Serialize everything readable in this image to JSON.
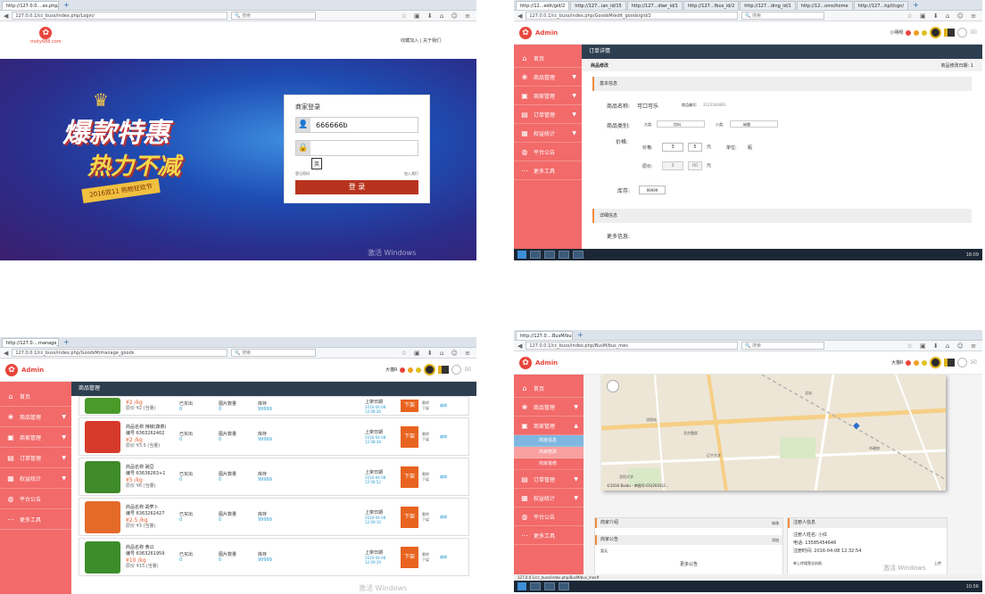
{
  "login": {
    "tab": "http://127.0.0....es.php/Login/",
    "url": "127.0.0.1/cc_buss/index.php/Login/",
    "search_placeholder": "搜索",
    "site": "moty688.com",
    "top_links": [
      "收藏加入",
      "关于我们"
    ],
    "banner": {
      "line1": "爆款特惠",
      "line2": "热力不减",
      "ribbon": "2016双11 购物狂欢节"
    },
    "form_title": "商家登录",
    "username": "666666b",
    "key_hint": "英",
    "remember": "登记密码",
    "register": "加入我们",
    "submit": "登 录",
    "watermark": "激活 Windows"
  },
  "edit": {
    "tabs": [
      "http://12...edit/gid/2",
      "http://127...ian_id/15",
      "http://127...diwr_id/1",
      "http://127...fbus_id/2",
      "http://127...ding_id/1",
      "http://12...oms/home",
      "http://127...hp/l/cgn/"
    ],
    "url": "127.0.0.1/cc_buss/index.php/GoodsM/edit_goods/gid/2",
    "search_placeholder": "搜索",
    "brand": "Admin",
    "user": "小明呀",
    "side": [
      "首页",
      "商品管理",
      "商家管理",
      "订单管理",
      "权益统计",
      "平台公告",
      "更多工具"
    ],
    "title": "订单详情",
    "subbar_left": "商品修改",
    "subbar_right": "商品修改日期: 1",
    "basic": "基本信息",
    "name_label": "商品名称:",
    "name_value": "可口可乐",
    "code_label": "商品编号:",
    "code_value": "2123344891",
    "cat_label": "商品类别:",
    "big": "大类:",
    "big_val": "饮料",
    "small": "小类:",
    "small_val": "碳酸",
    "price_label": "价格:",
    "price_sub": "价格:",
    "p1": "3",
    "p2": "5",
    "yuan": "元",
    "unit_label": "单位:",
    "unit": "瓶",
    "orig": "原价:",
    "o1": "3",
    "o2": "00",
    "stock_label": "库存:",
    "stock": "99999",
    "detail": "详细信息",
    "more": "更多信息:",
    "clock": "18:09"
  },
  "manage": {
    "tab": "http://127.0....manage_goods",
    "url": "127.0.0.1/cc_buss/index.php/GoodsM/manage_goods",
    "search_placeholder": "搜索",
    "brand": "Admin",
    "user": "大猫R",
    "side": [
      "首页",
      "商品管理",
      "商家管理",
      "订单管理",
      "权益统计",
      "平台公告",
      "更多工具"
    ],
    "title": "商品管理",
    "rows": [
      {
        "name": "",
        "code": "",
        "price": "¥2",
        "orig": "¥2",
        "sold": "0",
        "views": "0",
        "stock": "99999",
        "date": "2016-04-08 12:08:26"
      },
      {
        "name": "辣椒(蔬菜)",
        "code": "6363262402",
        "price": "¥2",
        "orig": "¥3.5",
        "sold": "0",
        "views": "0",
        "stock": "99999",
        "date": "2016-04-08 12:08:38"
      },
      {
        "name": "豌豆",
        "code": "63636263+1",
        "price": "¥5",
        "orig": "¥6",
        "sold": "0",
        "views": "0",
        "stock": "99999",
        "date": "2016-04-08 12:08:52"
      },
      {
        "name": "胡萝卜",
        "code": "6363262427",
        "price": "¥2.5",
        "orig": "¥3",
        "sold": "0",
        "views": "0",
        "stock": "99999",
        "date": "2016-04-08 12:09:10"
      },
      {
        "name": "黄瓜",
        "code": "6363261959",
        "price": "¥10",
        "orig": "¥15",
        "sold": "0",
        "views": "0",
        "stock": "99999",
        "date": "2016-04-08 12:09:19"
      }
    ],
    "labels": {
      "name": "商品名称",
      "code": "编号",
      "orig": "原价",
      "unit": "/kg",
      "tag": "(当量)",
      "sold": "已买出",
      "views": "图片数量",
      "stock": "库存",
      "shelf": "上架日期",
      "down": "下架",
      "del": "删除",
      "edit": "编辑"
    },
    "watermark": "激活 Windows"
  },
  "map": {
    "tab": "http://127.0....BusM/bus_mes",
    "url": "127.0.0.1/cc_buss/index.php/BusM/bus_mes",
    "search_placeholder": "搜索",
    "brand": "Admin",
    "user": "大猫R",
    "side": [
      "首页",
      "商品管理",
      "商家管理",
      "订单管理",
      "权益统计",
      "平台公告",
      "更多工具"
    ],
    "sub": [
      "商家信息",
      "商家修改",
      "商家装修"
    ],
    "places": [
      "沈阳大学",
      "北京雷部",
      "辽宁大学",
      "沈阳站",
      "北站",
      "市政府"
    ],
    "map_credit": "©2016 Baidu - 审图号:GS(2016)2...",
    "intro_title": "商家介绍",
    "intro_edit": "修改",
    "notice_title": "商家公告",
    "notice_add": "添加",
    "notice_item": "暂无",
    "notice_more": "更多公告",
    "reg_title": "注册人信息",
    "reg_name": "注册人姓名: 小红",
    "reg_phone": "电话: 13585454646",
    "reg_time": "注册时间: 2016-04-08 12:32:54",
    "reg_extra": "单上传理营业执照",
    "upload": "上传",
    "watermark": "激活 Windows",
    "status_url": "127.0.0.1/cc_buss/index.php/BusM/bus_mes#",
    "clock": "10:56"
  }
}
